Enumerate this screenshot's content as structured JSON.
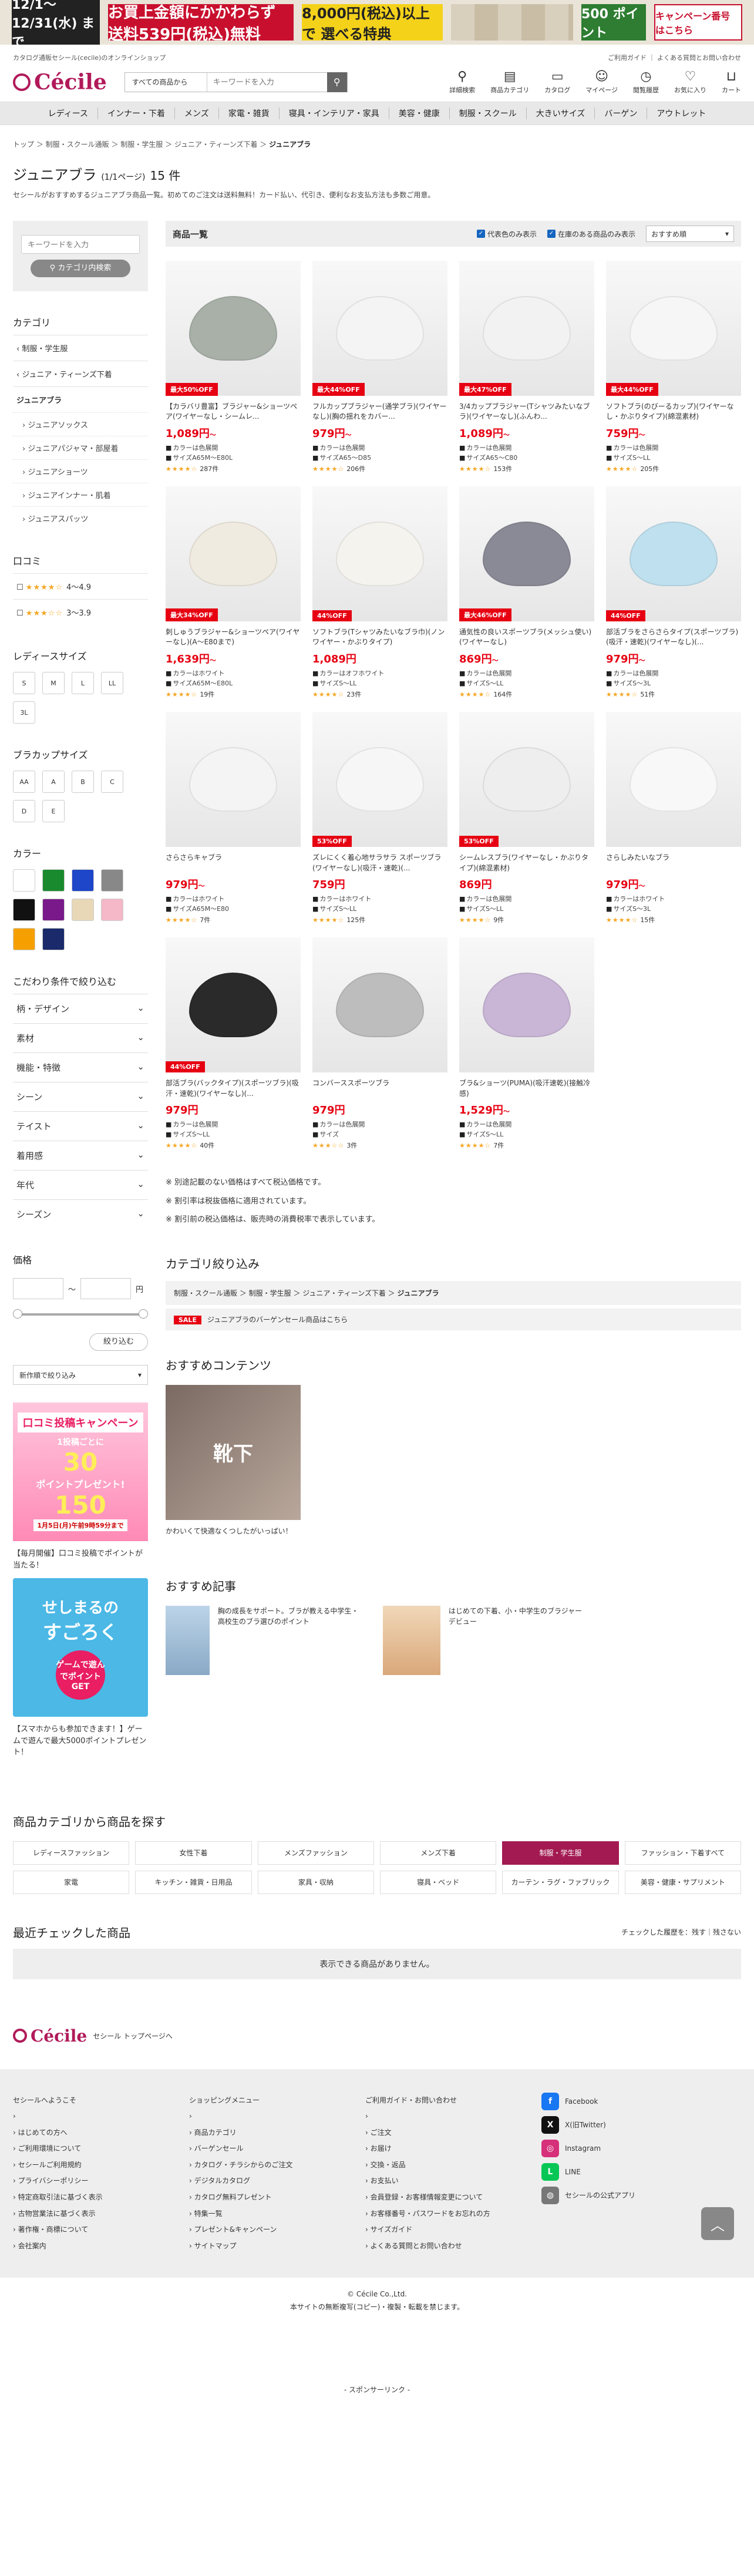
{
  "banner": {
    "date": "12/1〜 12/31(水) まで",
    "red": "お買上金額にかかわらず 送料539円(税込)無料",
    "yellow": "8,000円(税込)以上で 選べる特典",
    "points": "500 ポイント",
    "campaign": "キャンペーン番号 はこちら"
  },
  "top": {
    "tagline": "カタログ通販セシール(cecile)のオンラインショップ",
    "links": "ご利用ガイド ｜ よくある質問とお問い合わせ"
  },
  "header": {
    "logo": "Cécile",
    "search_category": "すべての商品から",
    "search_placeholder": "キーワードを入力",
    "icons": [
      {
        "g": "⚲",
        "label": "詳細検索"
      },
      {
        "g": "▤",
        "label": "商品カテゴリ"
      },
      {
        "g": "▭",
        "label": "カタログ"
      },
      {
        "g": "☺",
        "label": "マイページ"
      },
      {
        "g": "◷",
        "label": "閲覧履歴"
      },
      {
        "g": "♡",
        "label": "お気に入り"
      },
      {
        "g": "⊔",
        "label": "カート"
      }
    ]
  },
  "gnav": [
    "レディース",
    "インナー・下着",
    "メンズ",
    "家電・雑貨",
    "寝具・インテリア・家具",
    "美容・健康",
    "制服・スクール",
    "大きいサイズ",
    "バーゲン",
    "アウトレット"
  ],
  "breadcrumb": {
    "trail": "トップ ＞ 制服・スクール通販 ＞ 制服・学生服 ＞ ジュニア・ティーンズ下着 ＞ ",
    "current": "ジュニアブラ"
  },
  "title": {
    "main": "ジュニアブラ",
    "sub": "(1/1ページ)",
    "count": "15 件"
  },
  "description": "セシールがおすすめするジュニアブラ商品一覧。初めてのご注文は送料無料！カード払い、代引き、便利なお支払方法も多数ご用意。",
  "sidebar": {
    "kw_placeholder": "キーワードを入力",
    "kw_button": "⚲ カテゴリ内検索",
    "category_h": "カテゴリ",
    "cat_parent": "制服・学生服",
    "cat_sub": "ジュニア・ティーンズ下着",
    "cat_current": "ジュニアブラ",
    "cat_items": [
      "ジュニアソックス",
      "ジュニアパジャマ・部屋着",
      "ジュニアショーツ",
      "ジュニアインナー・肌着",
      "ジュニアスパッツ"
    ],
    "review_h": "口コミ",
    "reviews": [
      {
        "stars": "★★★★☆",
        "label": "4〜4.9"
      },
      {
        "stars": "★★★☆☆",
        "label": "3〜3.9"
      }
    ],
    "size_h": "レディースサイズ",
    "sizes": [
      "S",
      "M",
      "L",
      "LL",
      "3L"
    ],
    "cup_h": "ブラカップサイズ",
    "cups": [
      "AA",
      "A",
      "B",
      "C",
      "D",
      "E"
    ],
    "color_h": "カラー",
    "colors": [
      "#ffffff",
      "#1a8a2e",
      "#1e46c8",
      "#888888",
      "#111111",
      "#7a1a8a",
      "#e8d8b8",
      "#f4b8c8",
      "#f5a000",
      "#1a2a6a"
    ],
    "cond_h": "こだわり条件で絞り込む",
    "conds": [
      "柄・デザイン",
      "素材",
      "機能・特徴",
      "シーン",
      "テイスト",
      "着用感",
      "年代",
      "シーズン"
    ],
    "price_h": "価格",
    "price_unit": "円",
    "price_sep": "〜",
    "narrow_btn": "絞り込む",
    "sort_select": "新作順で絞り込み",
    "promo1": {
      "l1": "口コミ投稿キャンペーン",
      "l2": "1投稿ごとに",
      "l3": "30",
      "l4": "ポイントプレゼント!",
      "l5": "150",
      "l6": "1月5日(月)午前9時59分まで"
    },
    "promo1_cap": "【毎月開催】口コミ投稿でポイントが当たる！",
    "promo2": {
      "l1": "せしまるの",
      "l2": "すごろく",
      "badge": "ゲームで遊んでポイントGET"
    },
    "promo2_cap": "【スマホからも参加できます！】ゲームで遊んで最大5000ポイントプレゼント！"
  },
  "list": {
    "title": "商品一覧",
    "cb1": "代表色のみ表示",
    "cb2": "在庫のある商品のみ表示",
    "sort": "おすすめ順"
  },
  "products": [
    {
      "badge": "最大50%OFF",
      "name": "【カラバリ豊富】ブラジャー&ショーツペア(ワイヤーなし・シームレ...",
      "price": "1,089円",
      "tilde": "〜",
      "color": "カラーは色展開",
      "size": "サイズA65M〜E80L",
      "stars": "★★★★☆",
      "rev": "287件",
      "tone": "#a8b0a8"
    },
    {
      "badge": "最大44%OFF",
      "name": "フルカップブラジャー(通学ブラ)(ワイヤーなし)(胸の揺れをカバー...",
      "price": "979円",
      "tilde": "〜",
      "color": "カラーは色展開",
      "size": "サイズA65〜D85",
      "stars": "★★★★☆",
      "rev": "206件",
      "tone": "#f4f4f4"
    },
    {
      "badge": "最大47%OFF",
      "name": "3/4カップブラジャー(Tシャツみたいなブラ)(ワイヤーなし)(ふんわ...",
      "price": "1,089円",
      "tilde": "〜",
      "color": "カラーは色展開",
      "size": "サイズA65〜C80",
      "stars": "★★★★☆",
      "rev": "153件",
      "tone": "#f2f2f2"
    },
    {
      "badge": "最大44%OFF",
      "name": "ソフトブラ(のびーるカップ)(ワイヤーなし・かぶりタイプ)(綿混素材)",
      "price": "759円",
      "tilde": "〜",
      "color": "カラーは色展開",
      "size": "サイズS〜LL",
      "stars": "★★★★☆",
      "rev": "205件",
      "tone": "#f6f6f6"
    },
    {
      "badge": "最大34%OFF",
      "name": "刺しゅうブラジャー&ショーツペア(ワイヤーなし)(A〜E80まで)",
      "price": "1,639円",
      "tilde": "〜",
      "color": "カラーはホワイト",
      "size": "サイズA65M〜E80L",
      "stars": "★★★★☆",
      "rev": "19件",
      "tone": "#f0ebe0"
    },
    {
      "badge": "44%OFF",
      "name": "ソフトブラ(Tシャツみたいなブラ巾)(ノンワイヤー・かぶりタイプ)",
      "price": "1,089円",
      "tilde": "",
      "color": "カラーはオフホワイト",
      "size": "サイズS〜LL",
      "stars": "★★★★☆",
      "rev": "23件",
      "tone": "#f5f3ee"
    },
    {
      "badge": "最大46%OFF",
      "name": "通気性の良いスポーツブラ(メッシュ使い)(ワイヤーなし)",
      "price": "869円",
      "tilde": "〜",
      "color": "カラーは色展開",
      "size": "サイズS〜LL",
      "stars": "★★★★☆",
      "rev": "164件",
      "tone": "#8a8a96"
    },
    {
      "badge": "44%OFF",
      "name": "部活ブラをさらさらタイプ(スポーツブラ)(吸汗・速乾)(ワイヤーなし)(...",
      "price": "979円",
      "tilde": "〜",
      "color": "カラーは色展開",
      "size": "サイズS〜3L",
      "stars": "★★★★☆",
      "rev": "51件",
      "tone": "#bfe0ee"
    },
    {
      "badge": "",
      "name": "さらさらキャブラ",
      "price": "979円",
      "tilde": "〜",
      "color": "カラーはホワイト",
      "size": "サイズA65M〜E80",
      "stars": "★★★★☆",
      "rev": "7件",
      "tone": "#f4f4f4"
    },
    {
      "badge": "53%OFF",
      "name": "ズレにくく着心地サラサラ スポーツブラ(ワイヤーなし)(吸汗・速乾)(...",
      "price": "759円",
      "tilde": "",
      "color": "カラーはホワイト",
      "size": "サイズS〜LL",
      "stars": "★★★★☆",
      "rev": "125件",
      "tone": "#f6f6f6"
    },
    {
      "badge": "53%OFF",
      "name": "シームレスブラ(ワイヤーなし・かぶりタイプ)(綿混素材)",
      "price": "869円",
      "tilde": "",
      "color": "カラーは色展開",
      "size": "サイズS〜LL",
      "stars": "★★★★☆",
      "rev": "9件",
      "tone": "#eeeeee"
    },
    {
      "badge": "",
      "name": "さらしみたいなブラ",
      "price": "979円",
      "tilde": "〜",
      "color": "カラーはホワイト",
      "size": "サイズS〜3L",
      "stars": "★★★★☆",
      "rev": "15件",
      "tone": "#f8f8f8"
    },
    {
      "badge": "44%OFF",
      "name": "部活ブラ(バックタイプ)(スポーツブラ)(吸汗・速乾)(ワイヤーなし)(...",
      "price": "979円",
      "tilde": "",
      "color": "カラーは色展開",
      "size": "サイズS〜LL",
      "stars": "★★★★☆",
      "rev": "40件",
      "tone": "#2a2a2a"
    },
    {
      "badge": "",
      "name": "コンバーススポーツブラ",
      "price": "979円",
      "tilde": "",
      "color": "カラーは色展開",
      "size": "サイズ",
      "stars": "★★★☆☆",
      "rev": "3件",
      "tone": "#bdbdbd"
    },
    {
      "badge": "",
      "name": "ブラ&ショーツ(PUMA)(吸汗速乾)(接触冷感)",
      "price": "1,529円",
      "tilde": "〜",
      "color": "カラーは色展開",
      "size": "サイズS〜LL",
      "stars": "★★★★☆",
      "rev": "7件",
      "tone": "#c9b6d6"
    }
  ],
  "notes": [
    "※ 別途記載のない価格はすべて税込価格です。",
    "※ 割引率は税抜価格に適用されています。",
    "※ 割引前の税込価格は、販売時の消費税率で表示しています。"
  ],
  "cat_refine": {
    "title": "カテゴリ絞り込み",
    "trail": "制服・スクール通販 ＞ 制服・学生服 ＞ ジュニア・ティーンズ下着 ＞ ",
    "current": "ジュニアブラ",
    "sale_badge": "SALE",
    "sale_text": "ジュニアブラのバーゲンセール商品はこちら"
  },
  "recommend": {
    "title": "おすすめコンテンツ",
    "img_text": "靴下",
    "caption": "かわいくて快適なくつしたがいっぱい！"
  },
  "articles": {
    "title": "おすすめ記事",
    "items": [
      "胸の成長をサポート。ブラが教える中学生・高校生のブラ選びのポイント",
      "はじめての下着、小・中学生のブラジャーデビュー"
    ]
  },
  "cats": {
    "title": "商品カテゴリから商品を探す",
    "items": [
      "レディースファッション",
      "女性下着",
      "メンズファッション",
      "メンズ下着",
      "制服・学生服",
      "ファッション・下着すべて",
      "家電",
      "キッチン・雑貨・日用品",
      "家具・収納",
      "寝具・ベッド",
      "カーテン・ラグ・ファブリック",
      "美容・健康・サプリメント"
    ]
  },
  "recent": {
    "title": "最近チェックした商品",
    "ctl": "チェックした履歴を：残す｜残さない",
    "empty": "表示できる商品がありません。"
  },
  "footer": {
    "brand_sub": "セシール トップページへ",
    "col1_h": "セシールへようこそ",
    "col1": [
      "はじめての方へ",
      "ご利用環境について",
      "セシールご利用規約",
      "プライバシーポリシー",
      "特定商取引法に基づく表示",
      "古物営業法に基づく表示",
      "著作権・商標について",
      "会社案内"
    ],
    "col2_h": "ショッピングメニュー",
    "col2": [
      "商品カテゴリ",
      "バーゲンセール",
      "カタログ・チラシからのご注文",
      "デジタルカタログ",
      "カタログ無料プレゼント",
      "特集一覧",
      "プレゼント&キャンペーン",
      "サイトマップ"
    ],
    "col3_h": "ご利用ガイド・お問い合わせ",
    "col3": [
      "ご注文",
      "お届け",
      "交換・返品",
      "お支払い",
      "会員登録・お客様情報変更について",
      "お客様番号・パスワードをお忘れの方",
      "サイズガイド",
      "よくある質問とお問い合わせ"
    ],
    "social": [
      {
        "g": "f",
        "c": "#1877f2",
        "label": "Facebook"
      },
      {
        "g": "X",
        "c": "#111111",
        "label": "X(旧Twitter)"
      },
      {
        "g": "◎",
        "c": "#d6307a",
        "label": "Instagram"
      },
      {
        "g": "L",
        "c": "#06c755",
        "label": "LINE"
      },
      {
        "g": "◍",
        "c": "#777777",
        "label": "セシールの公式アプリ"
      }
    ],
    "copy1": "© Cécile Co.,Ltd.",
    "copy2": "本サイトの無断複写(コピー)・複製・転載を禁じます。",
    "sponsor": "- スポンサーリンク -"
  }
}
